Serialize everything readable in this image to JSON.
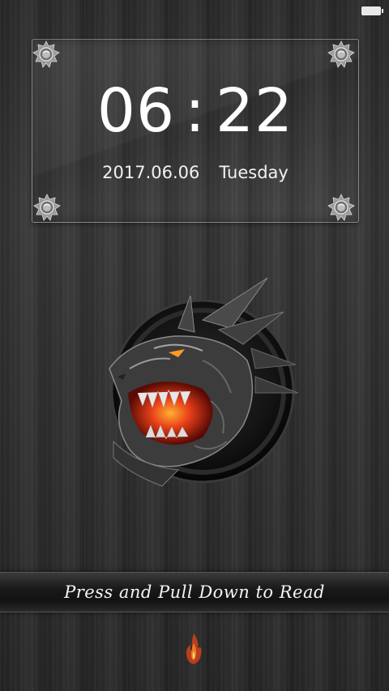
{
  "statusbar": {
    "battery_icon": "battery-full-icon"
  },
  "clock": {
    "hours": "06",
    "separator": ":",
    "minutes": "22",
    "date": "2017.06.06",
    "weekday": "Tuesday"
  },
  "panel": {
    "corner_icon": "gear-bolt-icon"
  },
  "artwork": {
    "icon": "dragon-emblem-icon"
  },
  "unlock": {
    "hint": "Press and Pull Down to Read",
    "handle_icon": "flame-icon"
  },
  "colors": {
    "background": "#333333",
    "text": "#ffffff",
    "accent": "#e8501c"
  }
}
